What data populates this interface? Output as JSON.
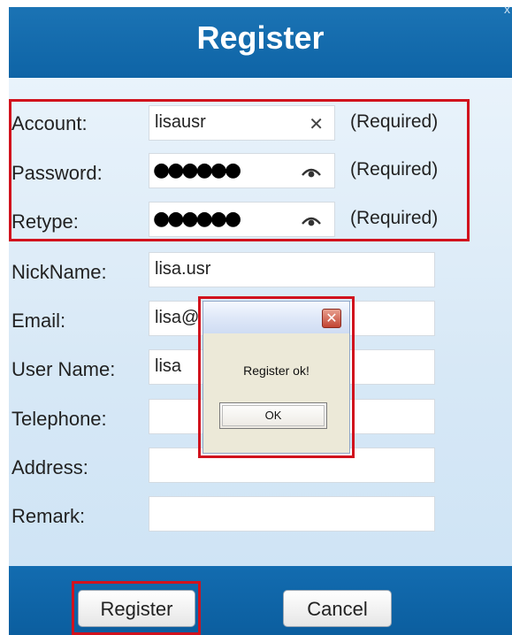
{
  "window": {
    "title": "Register",
    "corner_glyph": "x"
  },
  "form": {
    "account": {
      "label": "Account:",
      "value": "lisausr",
      "note": "(Required)",
      "icon": "clear-icon"
    },
    "password": {
      "label": "Password:",
      "value": "●●●●●●",
      "note": "(Required)",
      "icon": "eye-icon"
    },
    "retype": {
      "label": "Retype:",
      "value": "●●●●●●",
      "note": "(Required)",
      "icon": "eye-icon"
    },
    "nickname": {
      "label": "NickName:",
      "value": "lisa.usr"
    },
    "email": {
      "label": "Email:",
      "value": "lisa@"
    },
    "username": {
      "label": "User Name:",
      "value": "lisa"
    },
    "telephone": {
      "label": "Telephone:",
      "value": ""
    },
    "address": {
      "label": "Address:",
      "value": ""
    },
    "remark": {
      "label": "Remark:",
      "value": ""
    }
  },
  "buttons": {
    "register": "Register",
    "cancel": "Cancel"
  },
  "dialog": {
    "message": "Register ok!",
    "ok": "OK",
    "close_glyph": "✕"
  },
  "colors": {
    "header": "#0e64a6",
    "highlight": "#d1121d"
  }
}
